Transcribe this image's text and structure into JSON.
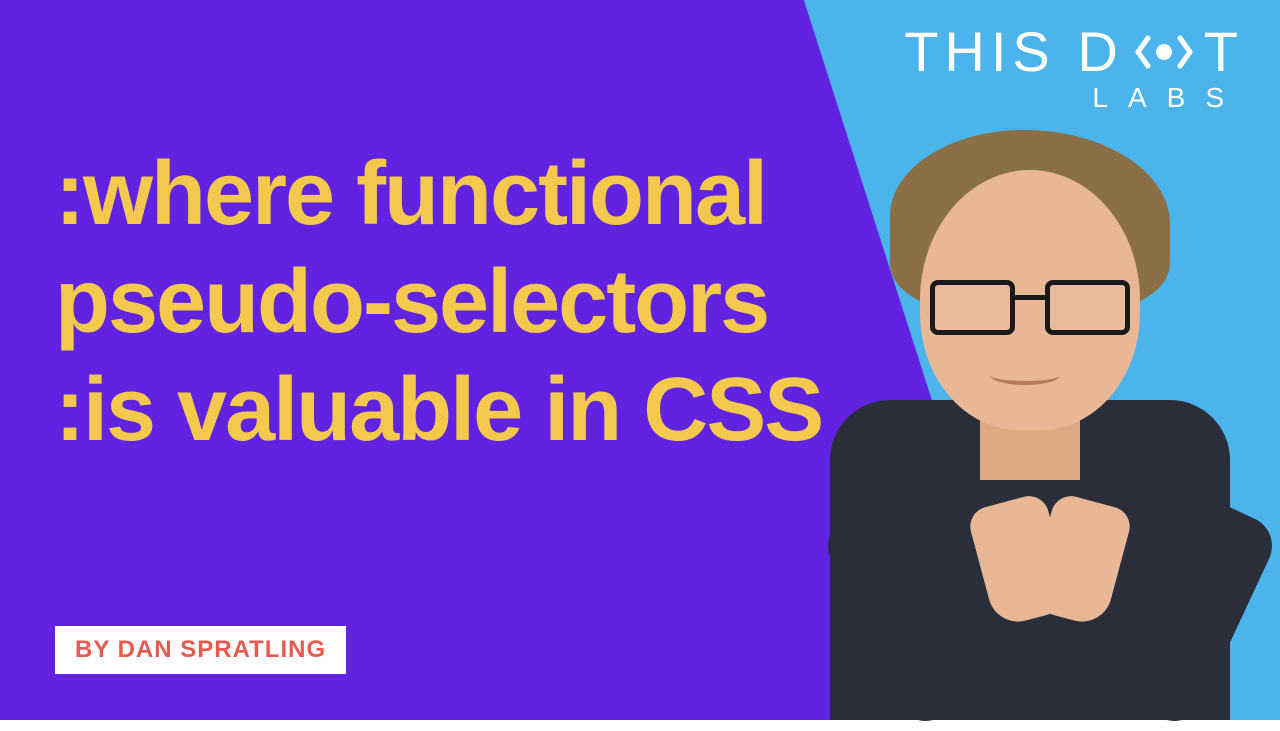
{
  "logo": {
    "main_text_1": "THIS D",
    "main_text_2": "T",
    "sub_text": "LABS"
  },
  "title": {
    "line1": ":where functional",
    "line2": "pseudo-selectors",
    "line3": ":is valuable in CSS"
  },
  "author": {
    "label": "BY DAN SPRATLING"
  },
  "colors": {
    "purple": "#6123e0",
    "blue": "#4bb4eb",
    "yellow": "#f2c94c",
    "coral": "#e85a4f"
  }
}
